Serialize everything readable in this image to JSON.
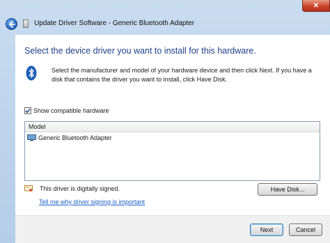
{
  "window": {
    "title": "Update Driver Software - Generic Bluetooth Adapter",
    "close_glyph": "✕"
  },
  "header": {
    "heading": "Select the device driver you want to install for this hardware.",
    "description": "Select the manufacturer and model of your hardware device and then click Next. If you have a disk that contains the driver you want to install, click Have Disk.",
    "icon": "bluetooth-icon"
  },
  "compatible": {
    "label": "Show compatible hardware",
    "checked": true
  },
  "model_list": {
    "column_header": "Model",
    "items": [
      {
        "label": "Generic Bluetooth Adapter",
        "icon": "monitor-icon"
      }
    ]
  },
  "signature": {
    "status": "This driver is digitally signed.",
    "link": "Tell me why driver signing is important",
    "have_disk_label": "Have Disk..."
  },
  "footer": {
    "next_label": "Next",
    "cancel_label": "Cancel"
  },
  "colors": {
    "heading": "#1e3f8a",
    "link": "#1a5ec7",
    "close_button": "#c9452a"
  }
}
